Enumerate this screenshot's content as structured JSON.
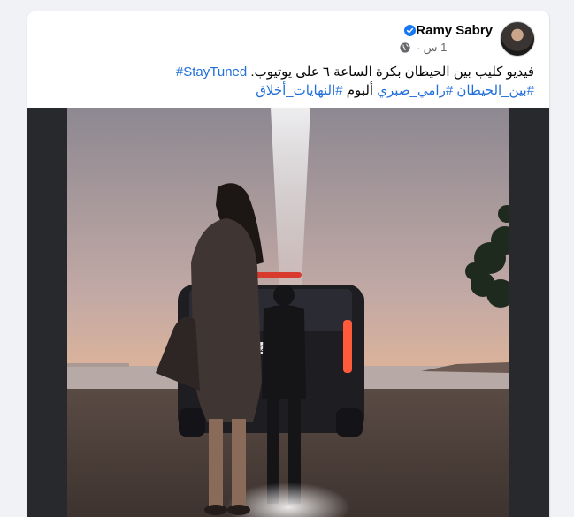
{
  "post": {
    "author_name": "Ramy Sabry",
    "timestamp": "1 س",
    "separator": "·",
    "text_line1_main": "فيديو كليب بين الحيطان بكرة الساعة ٦ على يوتيوب.",
    "text_line1_tag": "#StayTuned",
    "text_line2_tag1": "#بين_الحيطان",
    "text_line2_tag2": "#رامي_صبري",
    "text_line2_word": "ألبوم",
    "text_line2_tag3": "#النهايات_أخلاق",
    "license_plate": "230"
  },
  "icons": {
    "verified": "verified-badge-icon",
    "audience": "globe-icon"
  },
  "colors": {
    "hashtag": "#216fdb",
    "verified": "#1877f2",
    "secondary_text": "#65676b"
  }
}
